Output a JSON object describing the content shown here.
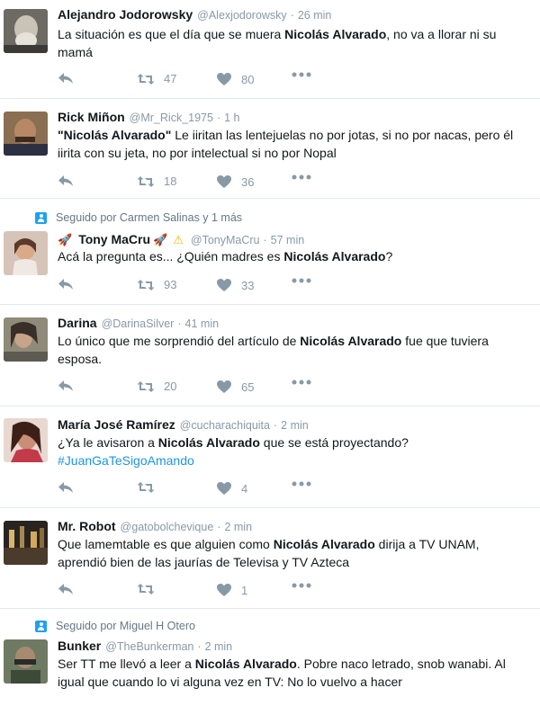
{
  "colors": {
    "text": "#14171a",
    "secondary": "#8899a6",
    "link": "#1b95e0",
    "divider": "#e1e8ed",
    "follow_badge": "#1da1f2"
  },
  "tweets": [
    {
      "name": "Alejandro Jodorowsky",
      "handle": "@Alexjodorowsky",
      "time": "26 min",
      "segments": [
        {
          "t": "La situación es que el día que se muera ",
          "b": false
        },
        {
          "t": "Nicolás Alvarado",
          "b": true
        },
        {
          "t": ", no va a llorar ni su mamá",
          "b": false
        }
      ],
      "retweets": "47",
      "likes": "80"
    },
    {
      "name": "Rick Miñon",
      "handle": "@Mr_Rick_1975",
      "time": "1 h",
      "segments": [
        {
          "t": "\"Nicolás Alvarado\"",
          "b": true
        },
        {
          "t": " Le iiritan las lentejuelas no por jotas, si no por nacas, pero él iirita con su jeta, no por intelectual si no por Nopal",
          "b": false
        }
      ],
      "retweets": "18",
      "likes": "36"
    },
    {
      "context": "Seguido por Carmen Salinas y 1 más",
      "name": "Tony MaCru",
      "handle": "@TonyMaCru",
      "time": "57 min",
      "segments": [
        {
          "t": "Acá la pregunta es... ¿Quién madres es ",
          "b": false
        },
        {
          "t": "Nicolás Alvarado",
          "b": true
        },
        {
          "t": "?",
          "b": false
        }
      ],
      "retweets": "93",
      "likes": "33"
    },
    {
      "name": "Darina",
      "handle": "@DarinaSilver",
      "time": "41 min",
      "segments": [
        {
          "t": "Lo único que me sorprendió del artículo de ",
          "b": false
        },
        {
          "t": "Nicolás Alvarado",
          "b": true
        },
        {
          "t": " fue que tuviera esposa.",
          "b": false
        }
      ],
      "retweets": "20",
      "likes": "65"
    },
    {
      "name": "María José Ramírez",
      "handle": "@cucharachiquita",
      "time": "2 min",
      "segments": [
        {
          "t": "¿Ya le avisaron a ",
          "b": false
        },
        {
          "t": "Nicolás Alvarado",
          "b": true
        },
        {
          "t": " que se está proyectando?",
          "b": false
        }
      ],
      "hashtag": "#JuanGaTeSigoAmando",
      "retweets": "",
      "likes": "4"
    },
    {
      "name": "Mr. Robot",
      "handle": "@gatobolchevique",
      "time": "2 min",
      "segments": [
        {
          "t": "Que lamemtable es que alguien como ",
          "b": false
        },
        {
          "t": "Nicolás Alvarado",
          "b": true
        },
        {
          "t": " dirija a TV UNAM, aprendió bien de las jaurías de Televisa y TV Azteca",
          "b": false
        }
      ],
      "retweets": "",
      "likes": "1"
    },
    {
      "context": "Seguido por Miguel H Otero",
      "name": "Bunker",
      "handle": "@TheBunkerman",
      "time": "2 min",
      "segments": [
        {
          "t": "Ser TT me llevó a leer a ",
          "b": false
        },
        {
          "t": "Nicolás Alvarado",
          "b": true
        },
        {
          "t": ". Pobre naco letrado, snob wanabi. Al igual que cuando lo vi alguna vez en TV: No lo vuelvo a hacer",
          "b": false
        }
      ]
    }
  ]
}
